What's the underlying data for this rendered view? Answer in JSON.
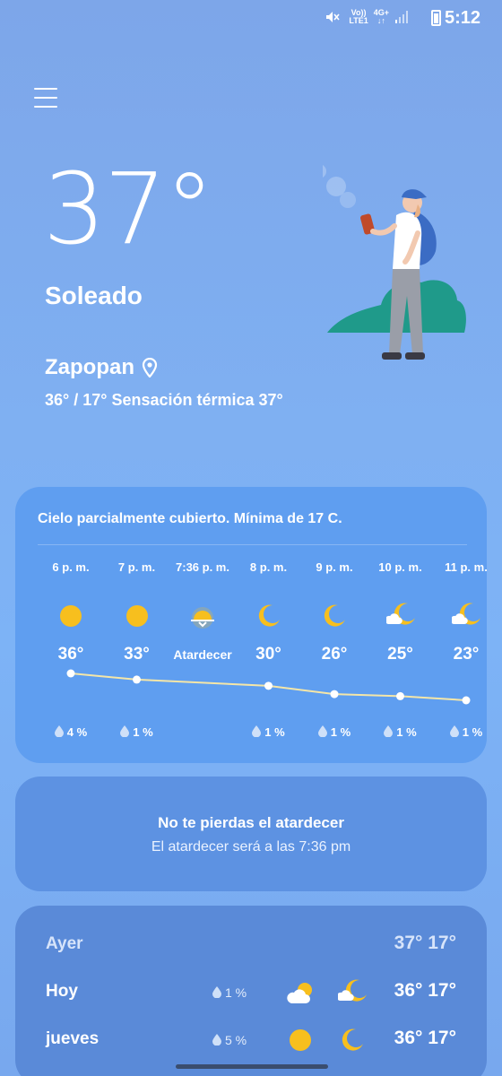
{
  "status_bar": {
    "time": "5:12",
    "network_top": "Vo))",
    "network_bottom": "LTE1",
    "net_type": "4G+"
  },
  "current": {
    "temperature": "37°",
    "condition": "Soleado",
    "location": "Zapopan",
    "summary": "36° / 17° Sensación térmica 37°"
  },
  "hourly": {
    "title": "Cielo parcialmente cubierto. Mínima de 17 C.",
    "items": [
      {
        "time": "6 p. m.",
        "icon": "sun-icon",
        "temp": "36°",
        "temp_value": 36,
        "precip": "4 %"
      },
      {
        "time": "7 p. m.",
        "icon": "sun-icon",
        "temp": "33°",
        "temp_value": 33,
        "precip": "1 %"
      },
      {
        "time": "7:36 p. m.",
        "icon": "sunset-icon",
        "temp": "Atardecer",
        "temp_value": null,
        "precip": ""
      },
      {
        "time": "8 p. m.",
        "icon": "moon-icon",
        "temp": "30°",
        "temp_value": 30,
        "precip": "1 %"
      },
      {
        "time": "9 p. m.",
        "icon": "moon-icon",
        "temp": "26°",
        "temp_value": 26,
        "precip": "1 %"
      },
      {
        "time": "10 p. m.",
        "icon": "moon-cloud-icon",
        "temp": "25°",
        "temp_value": 25,
        "precip": "1 %"
      },
      {
        "time": "11 p. m.",
        "icon": "moon-cloud-icon",
        "temp": "23°",
        "temp_value": 23,
        "precip": "1 %"
      }
    ]
  },
  "sunset_card": {
    "title": "No te pierdas el atardecer",
    "subtitle": "El atardecer será a las 7:36 pm"
  },
  "daily": [
    {
      "day": "Ayer",
      "precip": "",
      "icon_day": "",
      "icon_night": "",
      "temps": "37° 17°",
      "muted": true
    },
    {
      "day": "Hoy",
      "precip": "1 %",
      "icon_day": "cloud-sun-icon",
      "icon_night": "moon-cloud-icon",
      "temps": "36° 17°",
      "muted": false
    },
    {
      "day": "jueves",
      "precip": "5 %",
      "icon_day": "sun-icon",
      "icon_night": "moon-icon",
      "temps": "36° 17°",
      "muted": false
    }
  ],
  "colors": {
    "sun": "#f7bf1e",
    "graph_line": "#f4e6a8",
    "card": "#5f9ef0"
  }
}
